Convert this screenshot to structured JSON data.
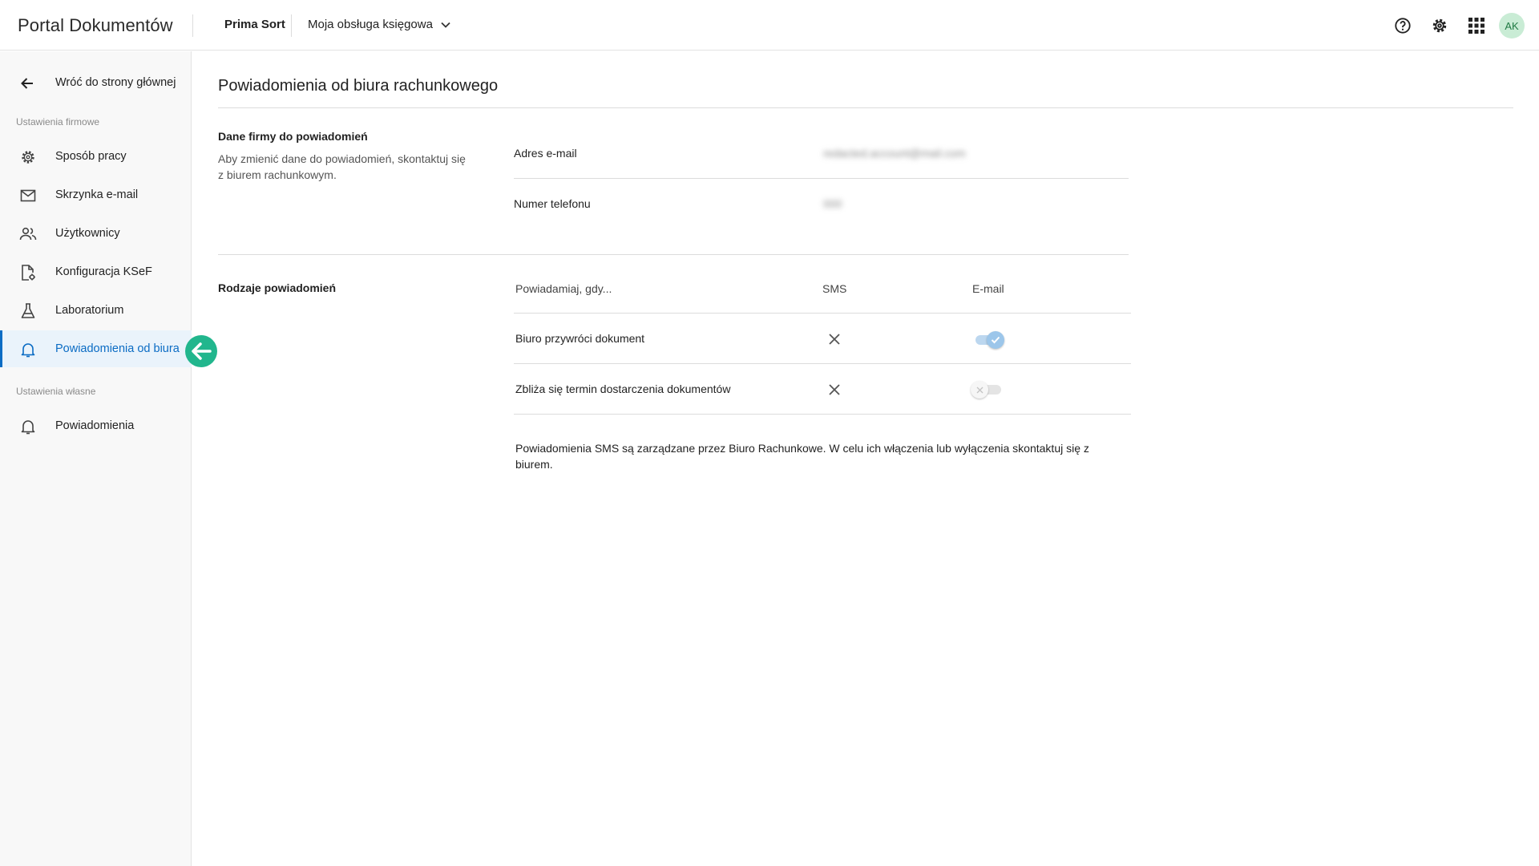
{
  "header": {
    "app_title": "Portal Dokumentów",
    "company": "Prima Sort",
    "service": "Moja obsługa księgowa",
    "avatar_initials": "AK",
    "icons": [
      "help-icon",
      "gear-icon",
      "apps-grid-icon"
    ]
  },
  "sidebar": {
    "back_label": "Wróć do strony głównej",
    "company_section_title": "Ustawienia firmowe",
    "items": [
      {
        "label": "Sposób pracy",
        "icon": "gear-icon"
      },
      {
        "label": "Skrzynka e-mail",
        "icon": "mail-icon"
      },
      {
        "label": "Użytkownicy",
        "icon": "users-icon"
      },
      {
        "label": "Konfiguracja KSeF",
        "icon": "document-settings-icon"
      },
      {
        "label": "Laboratorium",
        "icon": "flask-icon"
      },
      {
        "label": "Powiadomienia od biura",
        "icon": "bell-icon",
        "active": true
      }
    ],
    "own_section_title": "Ustawienia własne",
    "own_items": [
      {
        "label": "Powiadomienia",
        "icon": "bell-icon"
      }
    ]
  },
  "main": {
    "title": "Powiadomienia od biura rachunkowego",
    "company_data": {
      "heading": "Dane firmy do powiadomień",
      "description": "Aby zmienić dane do powiadomień, skontaktuj się z biurem rachunkowym.",
      "email_label": "Adres e-mail",
      "email_value": "redacted.account@mail.com",
      "phone_label": "Numer telefonu",
      "phone_value": "000"
    },
    "types": {
      "heading": "Rodzaje powiadomień",
      "col_event": "Powiadamiaj, gdy...",
      "col_sms": "SMS",
      "col_email": "E-mail",
      "rows": [
        {
          "label": "Biuro przywróci dokument",
          "sms": false,
          "email": true
        },
        {
          "label": "Zbliża się termin dostarczenia dokumentów",
          "sms": false,
          "email": false
        }
      ],
      "note": "Powiadomienia SMS są zarządzane przez Biuro Rachunkowe. W celu ich włączenia lub wyłączenia skontaktuj się z biurem."
    }
  },
  "colors": {
    "accent": "#0b6cc4",
    "active_bg": "#eaf3fb",
    "pointer": "#21b68d",
    "toggle_on": "#9cc6ea",
    "avatar_bg": "#c9ecd5"
  }
}
